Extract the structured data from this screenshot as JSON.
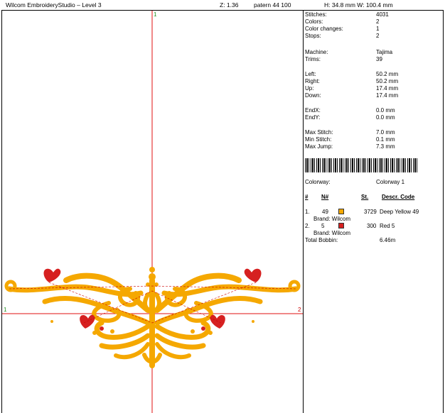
{
  "header": {
    "app_title": "Wilcom EmbroideryStudio – Level 3",
    "zoom": "Z: 1.36",
    "pattern": "patern 44  100",
    "size": "H: 34.8 mm  W: 100.4 mm"
  },
  "canvas": {
    "markers": {
      "top": "1",
      "left": "1",
      "right": "2"
    },
    "colors": {
      "guide": "#e01010",
      "yellow": "#f5a800",
      "red": "#d62020",
      "jump": "#cc0000"
    }
  },
  "stats": [
    {
      "label": "Stitches:",
      "value": "4031"
    },
    {
      "label": "Colors:",
      "value": "2"
    },
    {
      "label": "Color changes:",
      "value": "1"
    },
    {
      "label": "Stops:",
      "value": "2"
    },
    {
      "label": "Machine:",
      "value": "Tajima"
    },
    {
      "label": "Trims:",
      "value": "39"
    },
    {
      "label": "Left:",
      "value": "50.2 mm"
    },
    {
      "label": "Right:",
      "value": "50.2 mm"
    },
    {
      "label": "Up:",
      "value": "17.4 mm"
    },
    {
      "label": "Down:",
      "value": "17.4 mm"
    },
    {
      "label": "EndX:",
      "value": "0.0 mm"
    },
    {
      "label": "EndY:",
      "value": "0.0 mm"
    },
    {
      "label": "Max Stitch:",
      "value": "7.0 mm"
    },
    {
      "label": "Min Stitch:",
      "value": "0.1 mm"
    },
    {
      "label": "Max Jump:",
      "value": "7.3 mm"
    }
  ],
  "colorway": {
    "label": "Colorway:",
    "value": "Colorway 1"
  },
  "color_table": {
    "headers": {
      "num": "#",
      "n": "N#",
      "st": "St.",
      "descr": "Descr. Code"
    },
    "rows": [
      {
        "num": "1.",
        "n": "49",
        "color": "#f5a800",
        "stitches": "3729",
        "descr": "Deep Yellow 49",
        "brand": "Brand: Wilcom"
      },
      {
        "num": "2.",
        "n": "5",
        "color": "#d62020",
        "stitches": "300",
        "descr": "Red 5",
        "brand": "Brand: Wilcom"
      }
    ]
  },
  "bobbin": {
    "label": "Total Bobbin:",
    "value": "6.46m"
  }
}
